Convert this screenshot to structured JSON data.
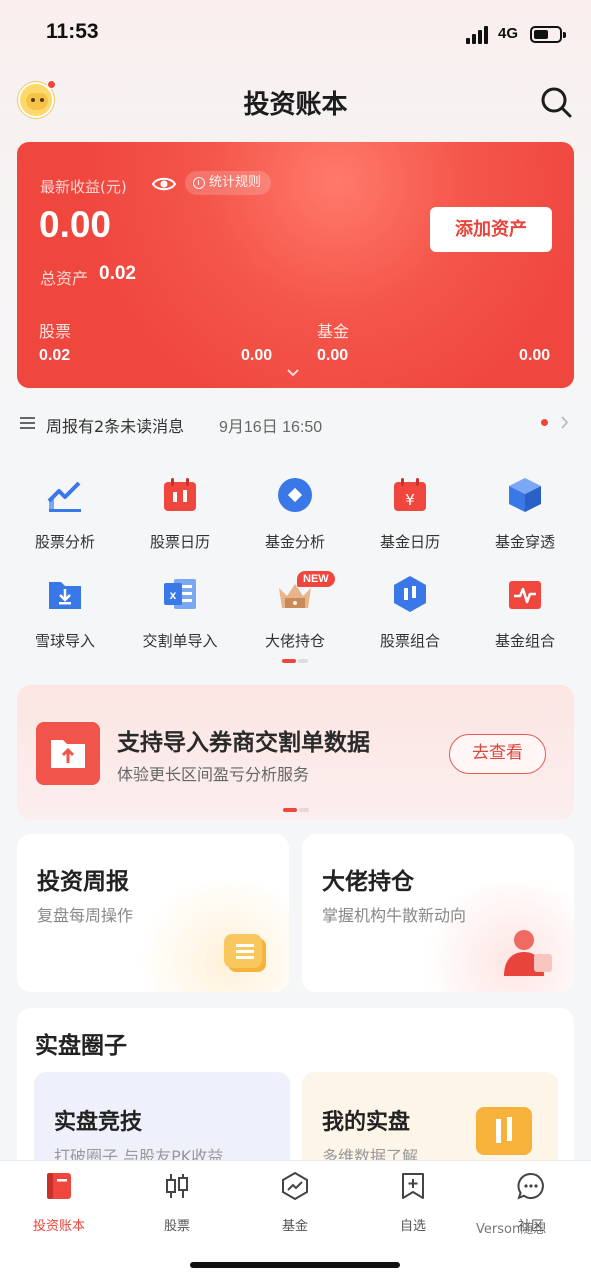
{
  "status_bar": {
    "time": "11:53",
    "network": "4G"
  },
  "header": {
    "title": "投资账本"
  },
  "summary_card": {
    "income_label": "最新收益(元)",
    "rules_label": "统计规则",
    "income_value": "0.00",
    "total_assets_label": "总资产",
    "total_assets_value": "0.02",
    "add_asset_button": "添加资产",
    "stock": {
      "label": "股票",
      "value_left": "0.02",
      "value_right": "0.00"
    },
    "fund": {
      "label": "基金",
      "value_left": "0.00",
      "value_right": "0.00"
    }
  },
  "notice": {
    "text": "周报有2条未读消息",
    "date": "9月16日 16:50"
  },
  "features": [
    {
      "label": "股票分析",
      "icon": "chart-trend-icon"
    },
    {
      "label": "股票日历",
      "icon": "calendar-candles-icon"
    },
    {
      "label": "基金分析",
      "icon": "diamond-circle-icon"
    },
    {
      "label": "基金日历",
      "icon": "calendar-yen-icon"
    },
    {
      "label": "基金穿透",
      "icon": "cube-icon"
    },
    {
      "label": "雪球导入",
      "icon": "folder-import-icon"
    },
    {
      "label": "交割单导入",
      "icon": "excel-icon"
    },
    {
      "label": "大佬持仓",
      "icon": "crown-box-icon",
      "badge": "NEW"
    },
    {
      "label": "股票组合",
      "icon": "hexagon-candles-icon"
    },
    {
      "label": "基金组合",
      "icon": "pulse-box-icon"
    }
  ],
  "banner": {
    "title": "支持导入券商交割单数据",
    "subtitle": "体验更长区间盈亏分析服务",
    "button": "去查看"
  },
  "cards": [
    {
      "title": "投资周报",
      "subtitle": "复盘每周操作"
    },
    {
      "title": "大佬持仓",
      "subtitle": "掌握机构牛散新动向"
    }
  ],
  "circle": {
    "title": "实盘圈子",
    "items": [
      {
        "title": "实盘竞技",
        "subtitle": "打破圈子 与股友PK收益"
      },
      {
        "title": "我的实盘",
        "subtitle": "多维数据了解"
      }
    ]
  },
  "tabs": [
    {
      "label": "投资账本",
      "active": true
    },
    {
      "label": "股票"
    },
    {
      "label": "基金"
    },
    {
      "label": "自选"
    },
    {
      "label": "社区"
    }
  ],
  "watermark": "Verson随想",
  "colors": {
    "accent": "#ef463e",
    "accent_text": "#e9443b",
    "background": "#f5f6f8"
  }
}
